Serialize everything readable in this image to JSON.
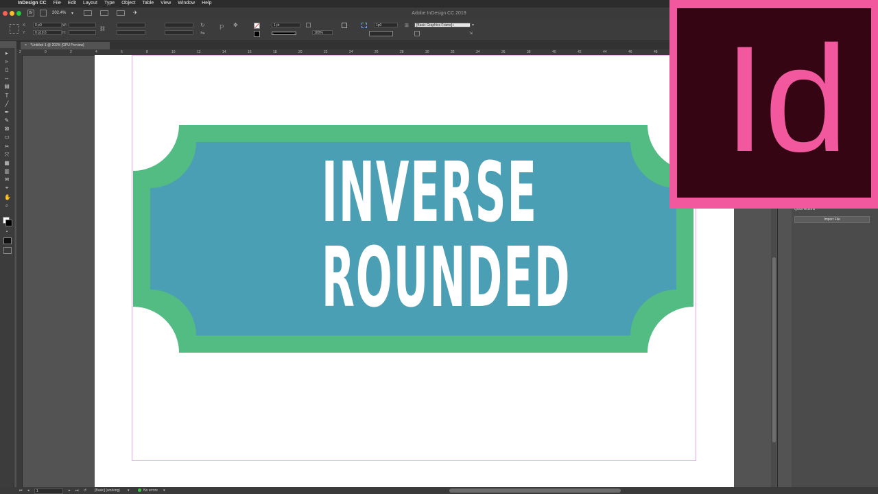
{
  "menubar": {
    "items": [
      "InDesign CC",
      "File",
      "Edit",
      "Layout",
      "Type",
      "Object",
      "Table",
      "View",
      "Window",
      "Help"
    ]
  },
  "window": {
    "title": "Adobe InDesign CC 2019",
    "zoom": "202.4%"
  },
  "control": {
    "x_label": "X:",
    "x_value": "0 p0",
    "y_label": "Y:",
    "y_value": "0 p10.6",
    "w_label": "W:",
    "h_label": "H:",
    "stroke_weight": "1 pt",
    "opacity": "100%",
    "corner": "1p0",
    "object_style": "[Basic Graphics Frame]+"
  },
  "document_tab": {
    "label": "*Untitled-1 @ 202% [GPU Preview]",
    "close": "×"
  },
  "ruler": {
    "h_ticks": [
      "2",
      "0",
      "2",
      "4",
      "6",
      "8",
      "10",
      "12",
      "14",
      "16",
      "18",
      "20",
      "22",
      "24",
      "26",
      "28",
      "30",
      "32",
      "34",
      "36",
      "38",
      "40",
      "42",
      "44",
      "46",
      "48",
      "50"
    ]
  },
  "artwork": {
    "line1": "INVERSE",
    "line2": "ROUNDED",
    "outer_color": "#52bc83",
    "inner_color": "#4a9fb5"
  },
  "right_panel": {
    "quick_actions": "Quick Actions",
    "import_button": "Import File"
  },
  "status": {
    "page": "1",
    "style": "[Basic] (working)",
    "errors": "No errors"
  },
  "logo": {
    "text": "Id",
    "bg": "#f2589d",
    "inner": "#350513"
  }
}
